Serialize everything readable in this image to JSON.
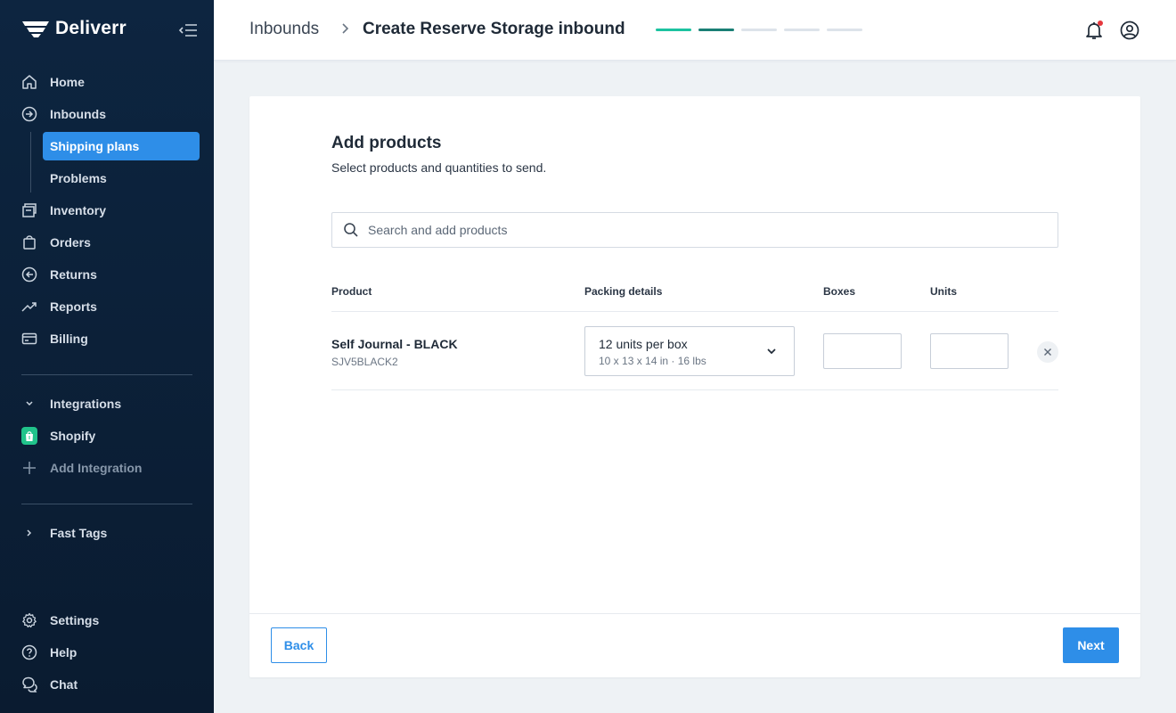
{
  "brand": {
    "name": "Deliverr"
  },
  "sidebar": {
    "items": [
      {
        "label": "Home",
        "icon": "home-icon"
      },
      {
        "label": "Inbounds",
        "icon": "inbound-arrow-icon"
      },
      {
        "label": "Inventory",
        "icon": "inventory-icon"
      },
      {
        "label": "Orders",
        "icon": "shopping-bag-icon"
      },
      {
        "label": "Returns",
        "icon": "return-arrow-icon"
      },
      {
        "label": "Reports",
        "icon": "trend-icon"
      },
      {
        "label": "Billing",
        "icon": "credit-card-icon"
      }
    ],
    "inbound_subitems": [
      {
        "label": "Shipping plans",
        "active": true
      },
      {
        "label": "Problems",
        "active": false
      }
    ],
    "integrations": {
      "label": "Integrations",
      "items": [
        {
          "label": "Shopify",
          "icon": "shopify-icon"
        },
        {
          "label": "Add Integration",
          "icon": "plus-icon"
        }
      ]
    },
    "fast_tags": {
      "label": "Fast Tags"
    },
    "bottom": [
      {
        "label": "Settings",
        "icon": "gear-icon"
      },
      {
        "label": "Help",
        "icon": "help-icon"
      },
      {
        "label": "Chat",
        "icon": "chat-icon"
      }
    ]
  },
  "header": {
    "breadcrumb_parent": "Inbounds",
    "title": "Create Reserve Storage inbound",
    "progress": {
      "total_steps": 5,
      "completed_steps": 1,
      "current_step": 2
    }
  },
  "main": {
    "title": "Add products",
    "subtitle": "Select products and quantities to send.",
    "search": {
      "placeholder": "Search and add products",
      "value": ""
    },
    "table": {
      "columns": [
        "Product",
        "Packing details",
        "Boxes",
        "Units"
      ],
      "rows": [
        {
          "name": "Self Journal - BLACK",
          "sku": "SJV5BLACK2",
          "packing": "12 units per box",
          "packing_detail": "10 x 13 x 14 in · 16 lbs",
          "boxes": "",
          "units": ""
        }
      ]
    },
    "buttons": {
      "back": "Back",
      "next": "Next"
    }
  },
  "colors": {
    "accent": "#2e8ee8",
    "sidebar_bg": "#0d2540",
    "progress_done": "#1cc3a0",
    "progress_current": "#1a7f75",
    "notification": "#e5373d",
    "shopify": "#21c38b"
  }
}
